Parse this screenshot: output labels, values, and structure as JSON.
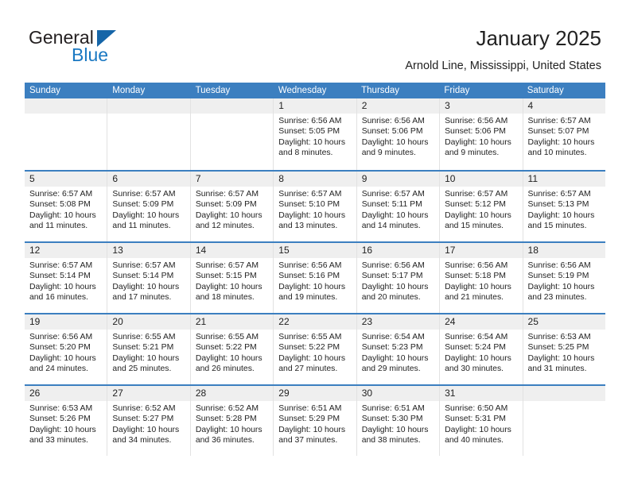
{
  "brand": {
    "name_part1": "General",
    "name_part2": "Blue",
    "accent_color": "#1a78c2",
    "triangle_color": "#1565a8"
  },
  "header": {
    "title": "January 2025",
    "subtitle": "Arnold Line, Mississippi, United States"
  },
  "theme": {
    "header_bar": "#3c7fc0",
    "daynum_band": "#efefef",
    "text": "#222222"
  },
  "weekdays": [
    "Sunday",
    "Monday",
    "Tuesday",
    "Wednesday",
    "Thursday",
    "Friday",
    "Saturday"
  ],
  "labels": {
    "sunrise": "Sunrise:",
    "sunset": "Sunset:",
    "daylight": "Daylight:"
  },
  "weeks": [
    [
      {
        "day": "",
        "sunrise": "",
        "sunset": "",
        "daylight": ""
      },
      {
        "day": "",
        "sunrise": "",
        "sunset": "",
        "daylight": ""
      },
      {
        "day": "",
        "sunrise": "",
        "sunset": "",
        "daylight": ""
      },
      {
        "day": "1",
        "sunrise": "Sunrise: 6:56 AM",
        "sunset": "Sunset: 5:05 PM",
        "daylight": "Daylight: 10 hours and 8 minutes."
      },
      {
        "day": "2",
        "sunrise": "Sunrise: 6:56 AM",
        "sunset": "Sunset: 5:06 PM",
        "daylight": "Daylight: 10 hours and 9 minutes."
      },
      {
        "day": "3",
        "sunrise": "Sunrise: 6:56 AM",
        "sunset": "Sunset: 5:06 PM",
        "daylight": "Daylight: 10 hours and 9 minutes."
      },
      {
        "day": "4",
        "sunrise": "Sunrise: 6:57 AM",
        "sunset": "Sunset: 5:07 PM",
        "daylight": "Daylight: 10 hours and 10 minutes."
      }
    ],
    [
      {
        "day": "5",
        "sunrise": "Sunrise: 6:57 AM",
        "sunset": "Sunset: 5:08 PM",
        "daylight": "Daylight: 10 hours and 11 minutes."
      },
      {
        "day": "6",
        "sunrise": "Sunrise: 6:57 AM",
        "sunset": "Sunset: 5:09 PM",
        "daylight": "Daylight: 10 hours and 11 minutes."
      },
      {
        "day": "7",
        "sunrise": "Sunrise: 6:57 AM",
        "sunset": "Sunset: 5:09 PM",
        "daylight": "Daylight: 10 hours and 12 minutes."
      },
      {
        "day": "8",
        "sunrise": "Sunrise: 6:57 AM",
        "sunset": "Sunset: 5:10 PM",
        "daylight": "Daylight: 10 hours and 13 minutes."
      },
      {
        "day": "9",
        "sunrise": "Sunrise: 6:57 AM",
        "sunset": "Sunset: 5:11 PM",
        "daylight": "Daylight: 10 hours and 14 minutes."
      },
      {
        "day": "10",
        "sunrise": "Sunrise: 6:57 AM",
        "sunset": "Sunset: 5:12 PM",
        "daylight": "Daylight: 10 hours and 15 minutes."
      },
      {
        "day": "11",
        "sunrise": "Sunrise: 6:57 AM",
        "sunset": "Sunset: 5:13 PM",
        "daylight": "Daylight: 10 hours and 15 minutes."
      }
    ],
    [
      {
        "day": "12",
        "sunrise": "Sunrise: 6:57 AM",
        "sunset": "Sunset: 5:14 PM",
        "daylight": "Daylight: 10 hours and 16 minutes."
      },
      {
        "day": "13",
        "sunrise": "Sunrise: 6:57 AM",
        "sunset": "Sunset: 5:14 PM",
        "daylight": "Daylight: 10 hours and 17 minutes."
      },
      {
        "day": "14",
        "sunrise": "Sunrise: 6:57 AM",
        "sunset": "Sunset: 5:15 PM",
        "daylight": "Daylight: 10 hours and 18 minutes."
      },
      {
        "day": "15",
        "sunrise": "Sunrise: 6:56 AM",
        "sunset": "Sunset: 5:16 PM",
        "daylight": "Daylight: 10 hours and 19 minutes."
      },
      {
        "day": "16",
        "sunrise": "Sunrise: 6:56 AM",
        "sunset": "Sunset: 5:17 PM",
        "daylight": "Daylight: 10 hours and 20 minutes."
      },
      {
        "day": "17",
        "sunrise": "Sunrise: 6:56 AM",
        "sunset": "Sunset: 5:18 PM",
        "daylight": "Daylight: 10 hours and 21 minutes."
      },
      {
        "day": "18",
        "sunrise": "Sunrise: 6:56 AM",
        "sunset": "Sunset: 5:19 PM",
        "daylight": "Daylight: 10 hours and 23 minutes."
      }
    ],
    [
      {
        "day": "19",
        "sunrise": "Sunrise: 6:56 AM",
        "sunset": "Sunset: 5:20 PM",
        "daylight": "Daylight: 10 hours and 24 minutes."
      },
      {
        "day": "20",
        "sunrise": "Sunrise: 6:55 AM",
        "sunset": "Sunset: 5:21 PM",
        "daylight": "Daylight: 10 hours and 25 minutes."
      },
      {
        "day": "21",
        "sunrise": "Sunrise: 6:55 AM",
        "sunset": "Sunset: 5:22 PM",
        "daylight": "Daylight: 10 hours and 26 minutes."
      },
      {
        "day": "22",
        "sunrise": "Sunrise: 6:55 AM",
        "sunset": "Sunset: 5:22 PM",
        "daylight": "Daylight: 10 hours and 27 minutes."
      },
      {
        "day": "23",
        "sunrise": "Sunrise: 6:54 AM",
        "sunset": "Sunset: 5:23 PM",
        "daylight": "Daylight: 10 hours and 29 minutes."
      },
      {
        "day": "24",
        "sunrise": "Sunrise: 6:54 AM",
        "sunset": "Sunset: 5:24 PM",
        "daylight": "Daylight: 10 hours and 30 minutes."
      },
      {
        "day": "25",
        "sunrise": "Sunrise: 6:53 AM",
        "sunset": "Sunset: 5:25 PM",
        "daylight": "Daylight: 10 hours and 31 minutes."
      }
    ],
    [
      {
        "day": "26",
        "sunrise": "Sunrise: 6:53 AM",
        "sunset": "Sunset: 5:26 PM",
        "daylight": "Daylight: 10 hours and 33 minutes."
      },
      {
        "day": "27",
        "sunrise": "Sunrise: 6:52 AM",
        "sunset": "Sunset: 5:27 PM",
        "daylight": "Daylight: 10 hours and 34 minutes."
      },
      {
        "day": "28",
        "sunrise": "Sunrise: 6:52 AM",
        "sunset": "Sunset: 5:28 PM",
        "daylight": "Daylight: 10 hours and 36 minutes."
      },
      {
        "day": "29",
        "sunrise": "Sunrise: 6:51 AM",
        "sunset": "Sunset: 5:29 PM",
        "daylight": "Daylight: 10 hours and 37 minutes."
      },
      {
        "day": "30",
        "sunrise": "Sunrise: 6:51 AM",
        "sunset": "Sunset: 5:30 PM",
        "daylight": "Daylight: 10 hours and 38 minutes."
      },
      {
        "day": "31",
        "sunrise": "Sunrise: 6:50 AM",
        "sunset": "Sunset: 5:31 PM",
        "daylight": "Daylight: 10 hours and 40 minutes."
      },
      {
        "day": "",
        "sunrise": "",
        "sunset": "",
        "daylight": ""
      }
    ]
  ]
}
